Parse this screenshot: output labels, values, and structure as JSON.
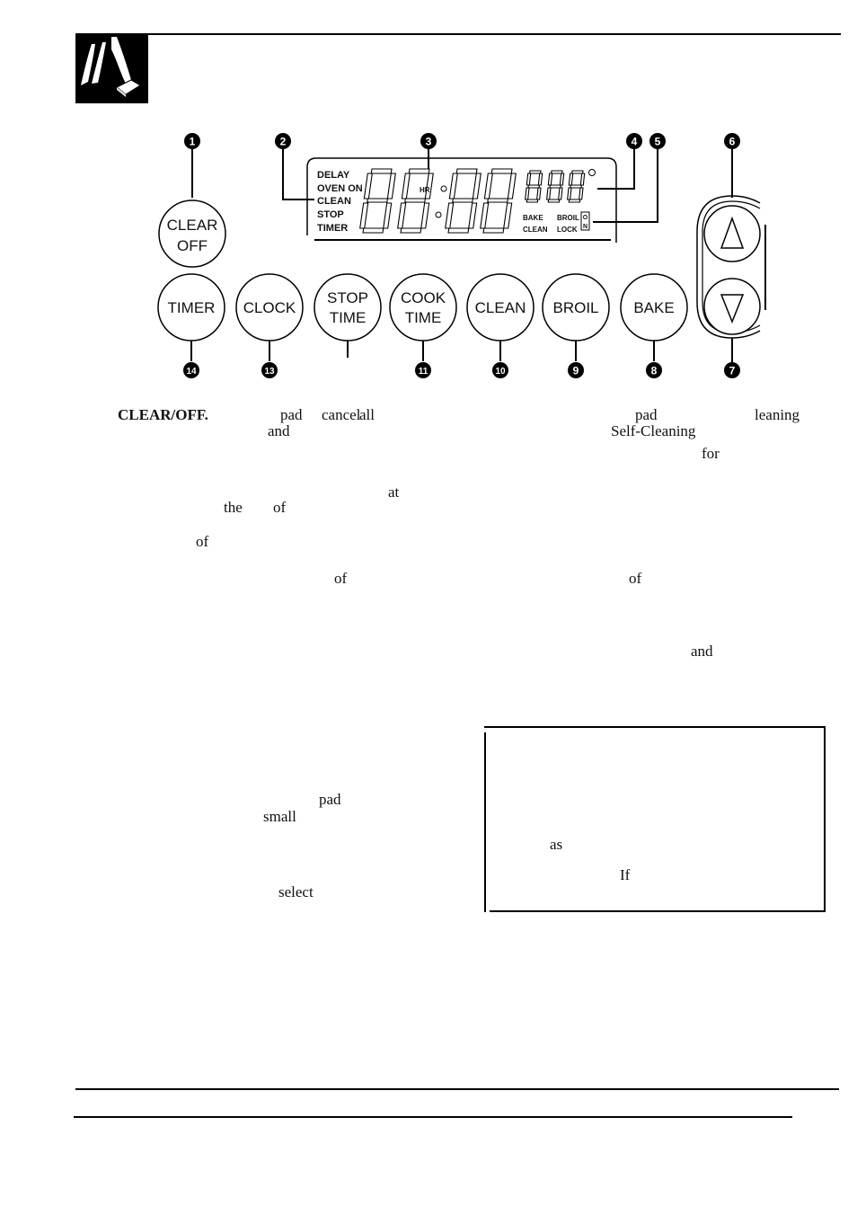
{
  "header": {
    "icon": "hand-pressing-pad-icon"
  },
  "diagram": {
    "pads": [
      {
        "id": "clear-off",
        "lines": [
          "CLEAR",
          "OFF"
        ],
        "callout": "1"
      },
      {
        "id": "timer",
        "lines": [
          "TIMER"
        ],
        "callout": "14"
      },
      {
        "id": "clock",
        "lines": [
          "CLOCK"
        ],
        "callout": "13"
      },
      {
        "id": "stop-time",
        "lines": [
          "STOP",
          "TIME"
        ],
        "callout": ""
      },
      {
        "id": "cook-time",
        "lines": [
          "COOK",
          "TIME"
        ],
        "callout": "11"
      },
      {
        "id": "clean",
        "lines": [
          "CLEAN"
        ],
        "callout": "10"
      },
      {
        "id": "broil",
        "lines": [
          "BROIL"
        ],
        "callout": "9"
      },
      {
        "id": "bake",
        "lines": [
          "BAKE"
        ],
        "callout": "8"
      }
    ],
    "arrows": {
      "up_callout": "6",
      "down_callout": "7",
      "up_icon": "up-arrow-icon",
      "down_icon": "down-arrow-icon"
    },
    "display": {
      "status_words": [
        "DELAY",
        "OVEN ON",
        "CLEAN",
        "STOP",
        "TIMER"
      ],
      "hr_label": "HR",
      "mode_words": {
        "bake": "BAKE",
        "broil": "BROIL",
        "clean": "CLEAN",
        "lock": "LOCK"
      },
      "on_indicator": [
        "O",
        "N"
      ],
      "callouts": {
        "status": "2",
        "time": "3",
        "temp": "4",
        "mode": "5"
      }
    }
  },
  "text_fragments": [
    {
      "text": "CLEAR/OFF.",
      "bold": true
    },
    {
      "text": "pad"
    },
    {
      "text": "cancel"
    },
    {
      "text": "all"
    },
    {
      "text": "and"
    },
    {
      "text": "pad"
    },
    {
      "text": "leaning"
    },
    {
      "text": "Self-Cleaning"
    },
    {
      "text": "for"
    },
    {
      "text": "at"
    },
    {
      "text": "the"
    },
    {
      "text": "of"
    },
    {
      "text": "of"
    },
    {
      "text": "of"
    },
    {
      "text": "of"
    },
    {
      "text": "and"
    },
    {
      "text": "pad"
    },
    {
      "text": "small"
    },
    {
      "text": "select"
    },
    {
      "text": "as"
    },
    {
      "text": "If"
    }
  ]
}
